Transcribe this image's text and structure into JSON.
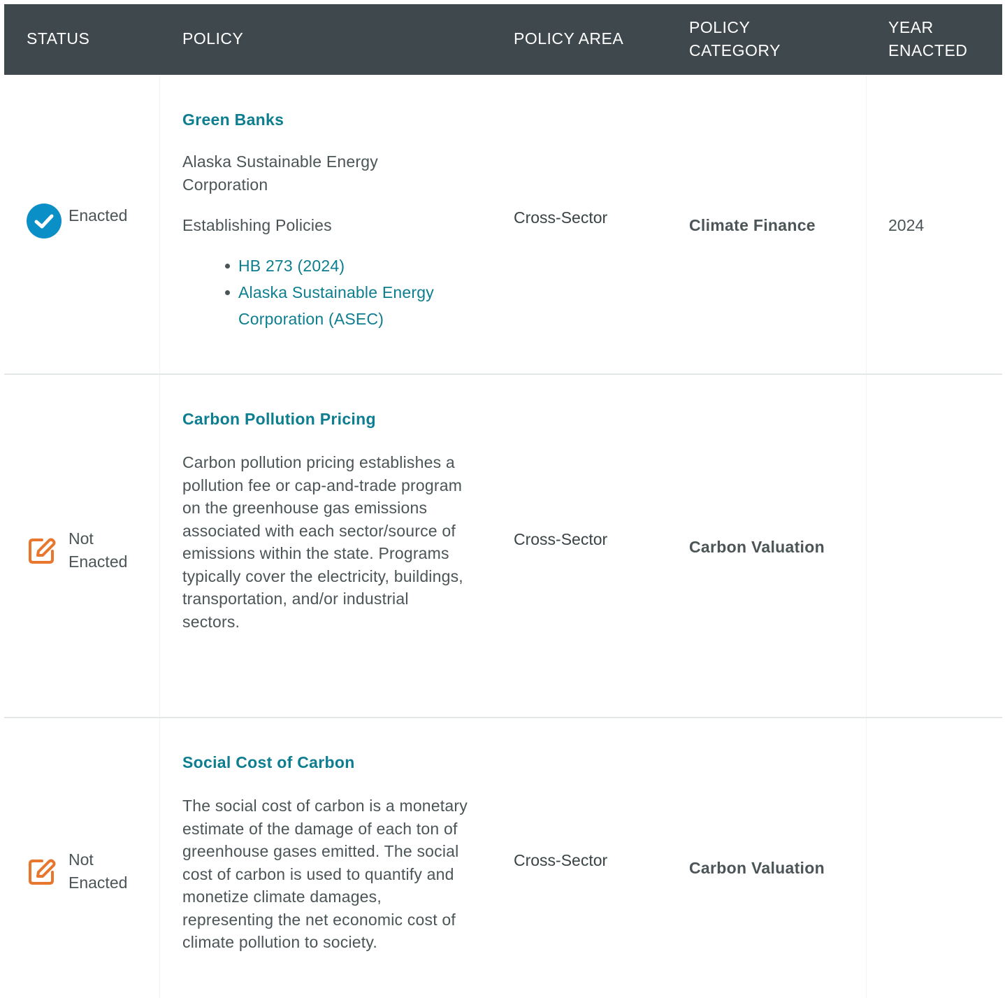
{
  "header": {
    "status": "STATUS",
    "policy": "POLICY",
    "policy_area": "POLICY AREA",
    "policy_category_line1": "POLICY",
    "policy_category_line2": "CATEGORY",
    "year_line1": "YEAR",
    "year_line2": "ENACTED"
  },
  "colors": {
    "header_bg": "#3e484d",
    "link": "#0d7e8f",
    "enacted_icon": "#0b8fc7",
    "not_enacted_icon": "#e8762d"
  },
  "rows": [
    {
      "status_icon": "check-circle-icon",
      "status_line1": "Enacted",
      "status_line2": "",
      "title": "Green Banks",
      "description_line1": "Alaska Sustainable Energy",
      "description_line2": "Corporation",
      "subheading": "Establishing Policies",
      "links": [
        "HB 273 (2024)",
        "Alaska Sustainable Energy Corporation (ASEC)"
      ],
      "policy_area": "Cross-Sector",
      "policy_category": "Climate Finance",
      "year_enacted": "2024"
    },
    {
      "status_icon": "edit-note-icon",
      "status_line1": "Not",
      "status_line2": "Enacted",
      "title": "Carbon Pollution Pricing",
      "description": "Carbon pollution pricing establishes a pollution fee or cap-and-trade program on the greenhouse gas emissions associated with each sector/source of emissions within the state. Programs typically cover the electricity, buildings, transportation, and/or industrial sectors.",
      "policy_area": "Cross-Sector",
      "policy_category": "Carbon Valuation",
      "year_enacted": ""
    },
    {
      "status_icon": "edit-note-icon",
      "status_line1": "Not",
      "status_line2": "Enacted",
      "title": "Social Cost of Carbon",
      "description": "The social cost of carbon is a monetary estimate of the damage of each ton of greenhouse gases emitted. The social cost of carbon is used to quantify and monetize climate damages, representing the net economic cost of climate pollution to society.",
      "policy_area": "Cross-Sector",
      "policy_category": "Carbon Valuation",
      "year_enacted": ""
    }
  ]
}
